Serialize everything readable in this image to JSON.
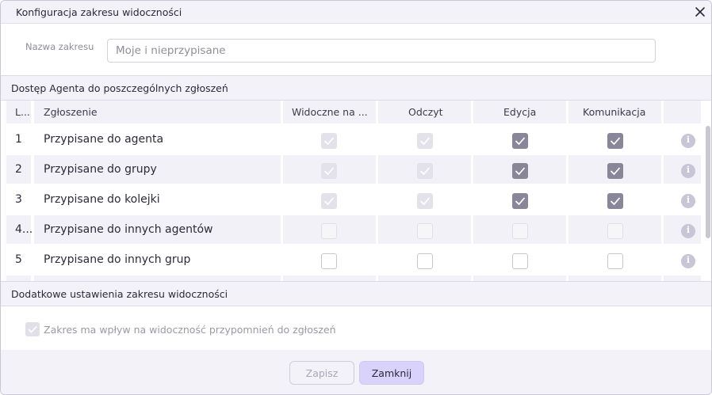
{
  "dialog": {
    "title": "Konfiguracja zakresu widoczności",
    "close_icon": "close-icon"
  },
  "name_field": {
    "label": "Nazwa zakresu",
    "value": "",
    "placeholder": "Moje i nieprzypisane"
  },
  "access_section": {
    "title": "Dostęp Agenta do poszczególnych zgłoszeń",
    "columns": {
      "lp": "L...",
      "ticket": "Zgłoszenie",
      "visible": "Widoczne na ...",
      "read": "Odczyt",
      "edit": "Edycja",
      "communication": "Komunikacja"
    },
    "rows": [
      {
        "lp": "1",
        "name": "Przypisane do agenta",
        "visible": "checked-disabled",
        "read": "checked-disabled",
        "edit": "checked",
        "communication": "checked",
        "info_icon": "info-icon"
      },
      {
        "lp": "2",
        "name": "Przypisane do grupy",
        "visible": "checked-disabled",
        "read": "checked-disabled",
        "edit": "checked",
        "communication": "checked",
        "info_icon": "info-icon"
      },
      {
        "lp": "3",
        "name": "Przypisane do kolejki",
        "visible": "checked-disabled",
        "read": "checked-disabled",
        "edit": "checked",
        "communication": "checked",
        "info_icon": "info-icon"
      },
      {
        "lp": "4...",
        "name": "Przypisane do innych agentów",
        "visible": "unchecked-disabled",
        "read": "unchecked-disabled",
        "edit": "unchecked-disabled",
        "communication": "unchecked-disabled",
        "info_icon": "info-icon"
      },
      {
        "lp": "5",
        "name": "Przypisane do innych grup",
        "visible": "unchecked",
        "read": "unchecked",
        "edit": "unchecked",
        "communication": "unchecked",
        "info_icon": "info-icon"
      }
    ]
  },
  "extra_section": {
    "title": "Dodatkowe ustawienia zakresu widoczności",
    "reminder_checkbox": {
      "label": "Zakres ma wpływ na widoczność przypomnień do zgłoszeń",
      "state": "checked-disabled"
    }
  },
  "footer": {
    "save_label": "Zapisz",
    "close_label": "Zamknij"
  },
  "colors": {
    "accent": "#d9d2fb",
    "header_bg": "#f3f2f9",
    "checked": "#8a8699"
  }
}
